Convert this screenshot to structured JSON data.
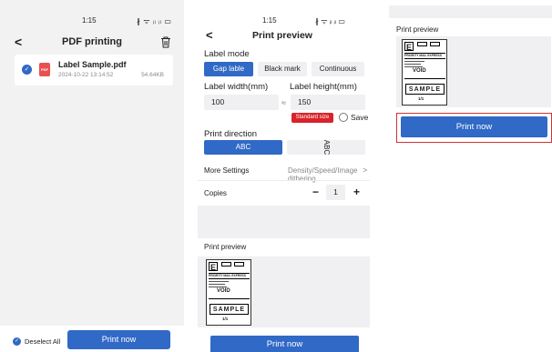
{
  "panel1": {
    "status": {
      "time": "1:15",
      "signal": "∦ ᯤ ᵢₗ ᵢₗ ▭"
    },
    "nav": {
      "back": "<",
      "title": "PDF printing"
    },
    "file": {
      "name": "Label Sample.pdf",
      "date": "2024-10-22 13:14:52",
      "size": "54.64KB",
      "type_badge": "PDF"
    },
    "bottom": {
      "select_label": "Deselect All",
      "print_button": "Print now"
    }
  },
  "panel2": {
    "status": {
      "time": "1:15",
      "signal": "∦ ᯤ ᵢₗ ᵢₗ ▭"
    },
    "nav": {
      "back": "<",
      "title": "Print preview"
    },
    "label_mode": {
      "title": "Label mode",
      "options": [
        "Gap lable",
        "Black mark",
        "Continuous"
      ],
      "selected": "Gap lable"
    },
    "label_width": {
      "title": "Label width(mm)",
      "value": "100"
    },
    "approx": "≈",
    "label_height": {
      "title": "Label height(mm)",
      "value": "150"
    },
    "standard_size": "Standard size",
    "save_label": "Save",
    "print_direction": {
      "title": "Print direction",
      "options": [
        "ABC",
        "ABC"
      ]
    },
    "more_settings": {
      "label": "More Settings",
      "hint": "Density/Speed/Image dithering",
      "chevron": ">"
    },
    "copies": {
      "label": "Copies",
      "minus": "−",
      "value": "1",
      "plus": "+"
    },
    "preview_title": "Print preview",
    "print_button": "Print now"
  },
  "panel3": {
    "preview_title": "Print preview",
    "print_button": "Print now"
  },
  "label_thumb": {
    "mark": "E",
    "service": "PRIORITY MAIL EXPRESS",
    "void": "VOID",
    "band": "SAMPLE",
    "tracking": "1/1"
  },
  "colors": {
    "accent": "#3069c6",
    "badge": "#d9232a",
    "highlight": "#d23232"
  }
}
